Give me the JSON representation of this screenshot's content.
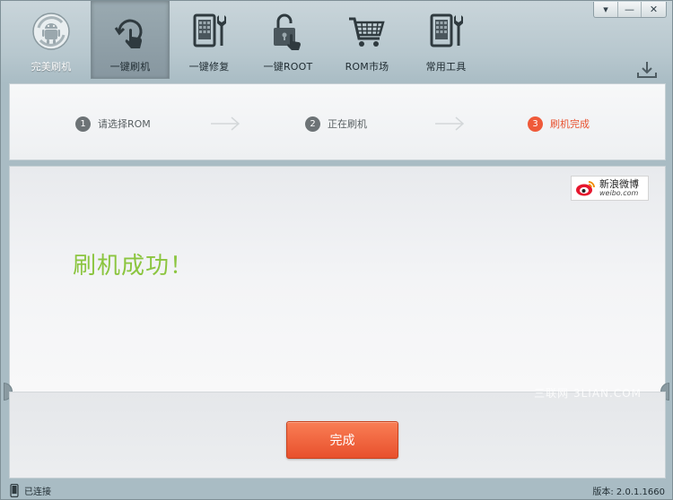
{
  "window": {
    "controls": {
      "menu_glyph": "▾",
      "minimize_glyph": "—",
      "close_glyph": "✕"
    }
  },
  "toolbar": {
    "items": [
      {
        "label": "完美刷机",
        "icon": "android-refresh-icon"
      },
      {
        "label": "一键刷机",
        "icon": "touch-refresh-icon"
      },
      {
        "label": "一键修复",
        "icon": "phone-repair-icon"
      },
      {
        "label": "一键ROOT",
        "icon": "unlock-icon"
      },
      {
        "label": "ROM市场",
        "icon": "shopping-cart-icon"
      },
      {
        "label": "常用工具",
        "icon": "phone-tools-icon"
      }
    ],
    "active_index": 1
  },
  "steps": {
    "items": [
      {
        "number": "1",
        "label": "请选择ROM"
      },
      {
        "number": "2",
        "label": "正在刷机"
      },
      {
        "number": "3",
        "label": "刷机完成"
      }
    ],
    "active_index": 2
  },
  "main": {
    "weibo_cn": "新浪微博",
    "weibo_en": "weibo.com",
    "success_message": "刷机成功！"
  },
  "footer": {
    "watermark": "三联网 3LIAN.COM",
    "done_label": "完成"
  },
  "status": {
    "connection": "已连接",
    "version": "版本: 2.0.1.1660"
  },
  "colors": {
    "accent": "#ef5a3a",
    "success": "#8bc53f",
    "button": "#f06a40"
  }
}
